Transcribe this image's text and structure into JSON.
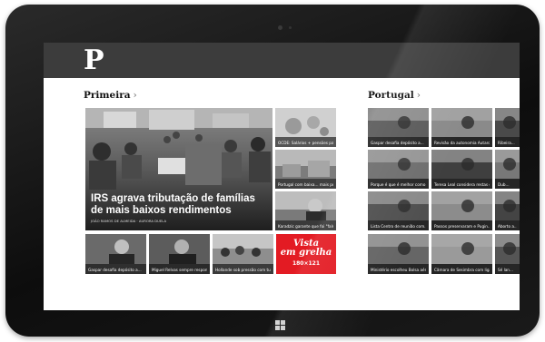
{
  "app": {
    "logo": "P"
  },
  "sections": {
    "primeira": {
      "label": "Primeira",
      "chevron": "›"
    },
    "portugal": {
      "label": "Portugal",
      "chevron": "›"
    }
  },
  "hero": {
    "headline": "IRS agrava tributação de famílias de mais baixos rendimentos",
    "byline": "JOÃO RAMOS DE ALMEIDA · AURORA DUELA"
  },
  "primeira_tiles": [
    {
      "caption": "OCDE: Salários + pensões pagam IPR..."
    },
    {
      "caption": "Portugal com baixa… mais pobres de..."
    },
    {
      "caption": "Karadzic garante que foi \"falso para o..."
    },
    {
      "caption": "Gaspar desafia depósito a..."
    },
    {
      "caption": "Miguel Relvas sempre responde ao..."
    },
    {
      "caption": "Hollande sob pressão com tumultos do..."
    }
  ],
  "ad": {
    "line1": "Vista",
    "line2": "em grelha",
    "size": "180×121"
  },
  "portugal_tiles": [
    {
      "caption": "Gaspar desafia depósito a..."
    },
    {
      "caption": "Revisão da autonomia Autarquia: Puberts e..."
    },
    {
      "caption": "Ribeira..."
    },
    {
      "caption": "Porque é que é melhor como contribuí..."
    },
    {
      "caption": "Teresa Leal considera restas do défice..."
    },
    {
      "caption": "Dub..."
    },
    {
      "caption": "Lista Centro de reunião com..."
    },
    {
      "caption": "Passos preservaram e Pugin..."
    },
    {
      "caption": "Aborto a..."
    },
    {
      "caption": "Ministério escolheu Bolsa aéreas..."
    },
    {
      "caption": "Câmara de Sesimbra com ligação..."
    },
    {
      "caption": "Sé lan..."
    }
  ],
  "colors": {
    "topbar": "#3c3c3c",
    "ad": "#e31b23",
    "bezel": "#111111"
  },
  "icons": {
    "windows": "windows-logo-icon"
  }
}
